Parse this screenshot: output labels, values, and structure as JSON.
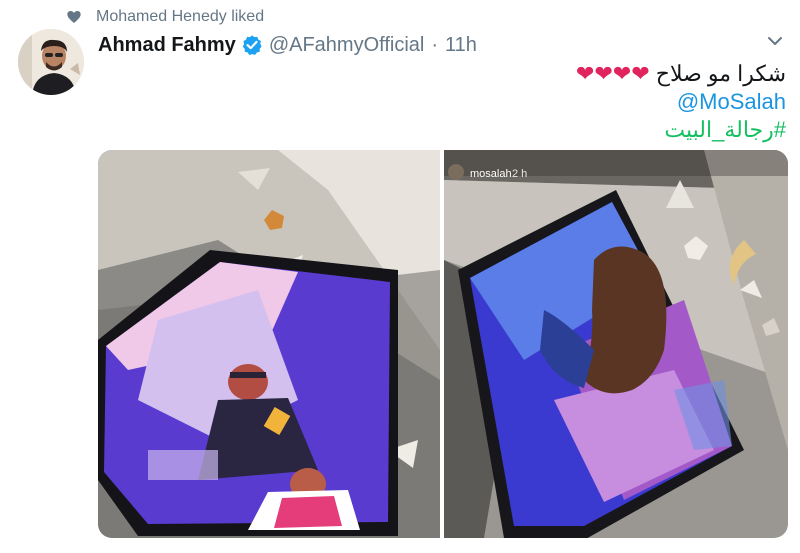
{
  "context": {
    "liked_text": "Mohamed Henedy liked",
    "heart_icon": "heart-icon"
  },
  "tweet": {
    "author_name": "Ahmad Fahmy",
    "handle": "@AFahmyOfficial",
    "separator": "·",
    "time": "11h",
    "text_line1": "شكرا مو صلاح",
    "hearts": "❤❤❤❤",
    "mention": "@MoSalah",
    "hashtag": "#رجالة_البيت"
  },
  "media": {
    "right_story_user": "mosalah",
    "right_story_time": "2 h"
  },
  "colors": {
    "link": "#1b95e0",
    "hashtag": "#17bf63",
    "heart": "#e0245e",
    "secondary": "#657786",
    "verified": "#1da1f2"
  }
}
